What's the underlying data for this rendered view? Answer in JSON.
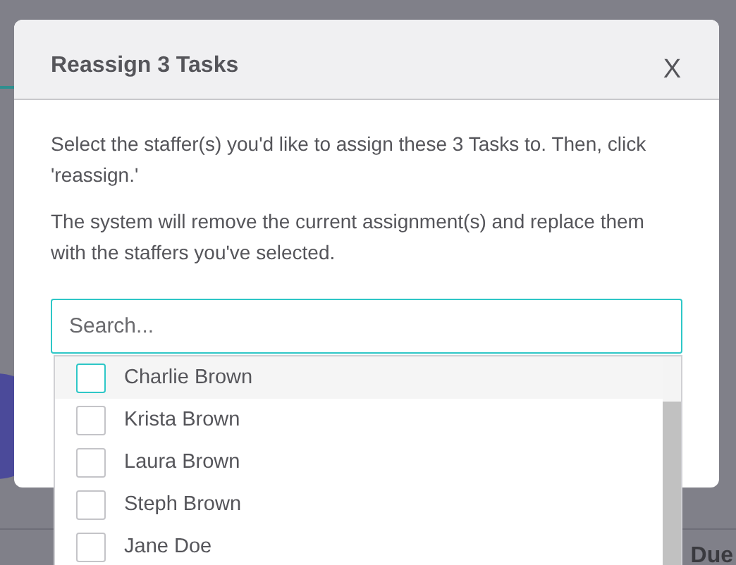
{
  "background": {
    "column_header": "Due"
  },
  "modal": {
    "title": "Reassign 3 Tasks",
    "close": "X",
    "paragraphs": [
      "Select the staffer(s) you'd like to assign these 3 Tasks to. Then, click 'reassign.'",
      "The system will remove the current assignment(s) and replace them with the staffers you've selected."
    ],
    "search": {
      "placeholder": "Search..."
    },
    "staffers": [
      {
        "name": "Charlie Brown",
        "checked": false,
        "highlighted": true
      },
      {
        "name": "Krista Brown",
        "checked": false,
        "highlighted": false
      },
      {
        "name": "Laura Brown",
        "checked": false,
        "highlighted": false
      },
      {
        "name": "Steph Brown",
        "checked": false,
        "highlighted": false
      },
      {
        "name": "Jane Doe",
        "checked": false,
        "highlighted": false
      }
    ]
  }
}
